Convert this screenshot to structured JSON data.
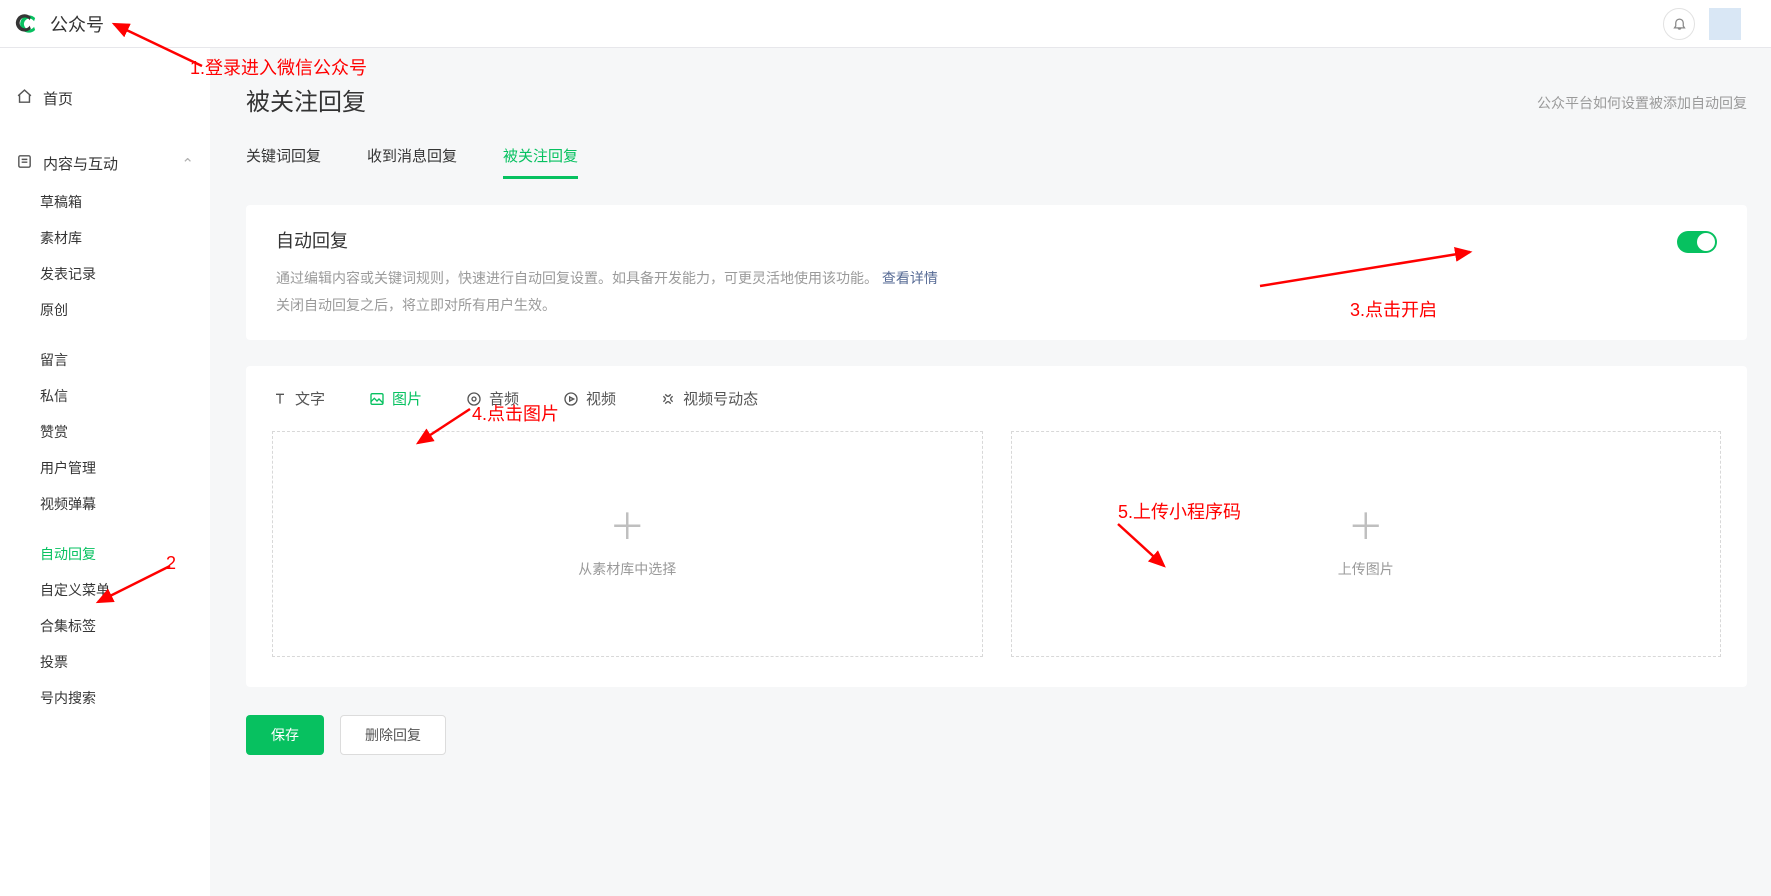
{
  "header": {
    "brand": "公众号"
  },
  "sidebar": {
    "home": "首页",
    "group1_label": "内容与互动",
    "items": [
      "草稿箱",
      "素材库",
      "发表记录",
      "原创"
    ],
    "items2": [
      "留言",
      "私信",
      "赞赏",
      "用户管理",
      "视频弹幕"
    ],
    "items3": [
      "自动回复",
      "自定义菜单",
      "合集标签",
      "投票",
      "号内搜索"
    ]
  },
  "page": {
    "title": "被关注回复",
    "help_link": "公众平台如何设置被添加自动回复"
  },
  "tabs": {
    "t1": "关键词回复",
    "t2": "收到消息回复",
    "t3": "被关注回复"
  },
  "auto": {
    "title": "自动回复",
    "desc1": "通过编辑内容或关键词规则，快速进行自动回复设置。如具备开发能力，可更灵活地使用该功能。",
    "link": "查看详情",
    "desc2": "关闭自动回复之后，将立即对所有用户生效。"
  },
  "typetabs": {
    "text": "文字",
    "image": "图片",
    "audio": "音频",
    "video": "视频",
    "channel": "视频号动态"
  },
  "drop": {
    "from_lib": "从素材库中选择",
    "upload": "上传图片"
  },
  "buttons": {
    "save": "保存",
    "delete": "删除回复"
  },
  "annotations": {
    "a1": "1.登录进入微信公众号",
    "a2": "2",
    "a3": "3.点击开启",
    "a4": "4.点击图片",
    "a5": "5.上传小程序码"
  }
}
